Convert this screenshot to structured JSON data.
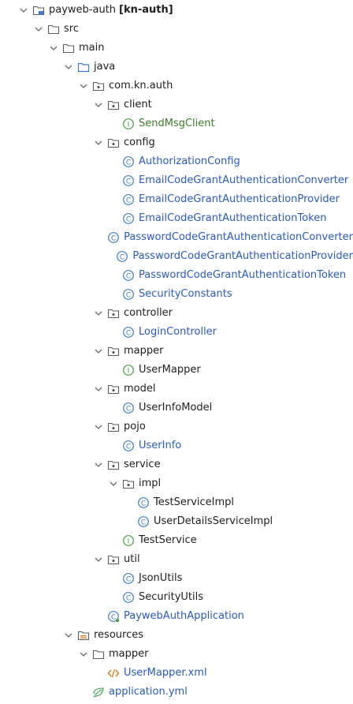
{
  "tree": {
    "root": {
      "name": "payweb-auth",
      "module": "[kn-auth]"
    },
    "src": "src",
    "main": "main",
    "java": "java",
    "package": "com.kn.auth",
    "client": {
      "name": "client",
      "items": [
        "SendMsgClient"
      ]
    },
    "config": {
      "name": "config",
      "items": [
        "AuthorizationConfig",
        "EmailCodeGrantAuthenticationConverter",
        "EmailCodeGrantAuthenticationProvider",
        "EmailCodeGrantAuthenticationToken",
        "PasswordCodeGrantAuthenticationConverter",
        "PasswordCodeGrantAuthenticationProvider",
        "PasswordCodeGrantAuthenticationToken",
        "SecurityConstants"
      ]
    },
    "controller": {
      "name": "controller",
      "items": [
        "LoginController"
      ]
    },
    "mapper": {
      "name": "mapper",
      "items": [
        "UserMapper"
      ]
    },
    "model": {
      "name": "model",
      "items": [
        "UserInfoModel"
      ]
    },
    "pojo": {
      "name": "pojo",
      "items": [
        "UserInfo"
      ]
    },
    "service": {
      "name": "service",
      "impl": {
        "name": "impl",
        "items": [
          "TestServiceImpl",
          "UserDetailsServiceImpl"
        ]
      },
      "items": [
        "TestService"
      ]
    },
    "util": {
      "name": "util",
      "items": [
        "JsonUtils",
        "SecurityUtils"
      ]
    },
    "app_class": "PaywebAuthApplication",
    "resources": {
      "name": "resources",
      "mapper": {
        "name": "mapper",
        "items": [
          "UserMapper.xml"
        ]
      },
      "yml": "application.yml"
    }
  },
  "colors": {
    "class_icon": "#3d7bd6",
    "interface_icon": "#46a040",
    "folder": "#5c5c5c",
    "source_folder": "#3d7bd6",
    "xml_icon": "#e07a1f",
    "yml_icon": "#4aa65a"
  }
}
